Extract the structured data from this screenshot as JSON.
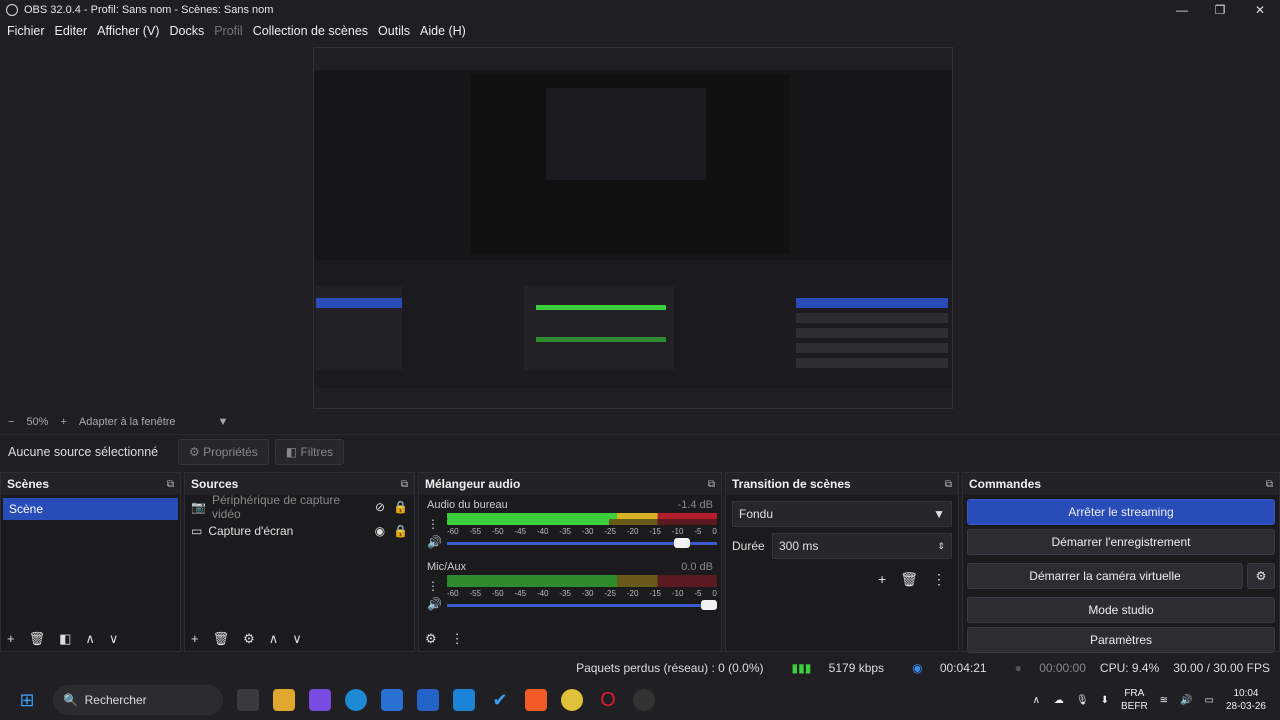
{
  "window": {
    "title": "OBS 32.0.4 - Profil: Sans nom - Scènes: Sans nom"
  },
  "menu": [
    "Fichier",
    "Editer",
    "Afficher (V)",
    "Docks",
    "Profil",
    "Collection de scènes",
    "Outils",
    "Aide (H)"
  ],
  "zoom": {
    "minus": "−",
    "level": "50%",
    "plus": "+",
    "fit": "Adapter à la fenêtre"
  },
  "sourcebar": {
    "none_selected": "Aucune source sélectionné",
    "properties": "Propriétés",
    "filters": "Filtres"
  },
  "scenes": {
    "title": "Scènes",
    "items": [
      "Scène"
    ]
  },
  "sources": {
    "title": "Sources",
    "items": [
      {
        "name": "Périphérique de capture vidéo",
        "icon": "camera-icon",
        "hidden": true
      },
      {
        "name": "Capture d'écran",
        "icon": "monitor-icon",
        "hidden": false
      }
    ]
  },
  "mixer": {
    "title": "Mélangeur audio",
    "channels": [
      {
        "name": "Audio du bureau",
        "db": "-1.4 dB",
        "level": 0.63,
        "fader": 0.9
      },
      {
        "name": "Mic/Aux",
        "db": "0.0 dB",
        "level": 0.63,
        "fader": 1.0
      }
    ],
    "scale": [
      "-60",
      "-55",
      "-50",
      "-45",
      "-40",
      "-35",
      "-30",
      "-25",
      "-20",
      "-15",
      "-10",
      "-5",
      "0"
    ]
  },
  "transitions": {
    "title": "Transition de scènes",
    "selected": "Fondu",
    "duration_label": "Durée",
    "duration": "300 ms"
  },
  "controls": {
    "title": "Commandes",
    "buttons": [
      "Arrêter le streaming",
      "Démarrer l'enregistrement",
      "Démarrer la caméra virtuelle",
      "Mode studio",
      "Paramètres"
    ]
  },
  "status": {
    "dropped": "Paquets perdus (réseau) : 0 (0.0%)",
    "bitrate": "5179 kbps",
    "stream_time": "00:04:21",
    "rec_time": "00:00:00",
    "cpu": "CPU: 9.4%",
    "fps": "30.00 / 30.00 FPS"
  },
  "taskbar": {
    "search": "Rechercher",
    "lang1": "FRA",
    "lang2": "BEFR",
    "time": "10:04",
    "date": "28-03-26"
  },
  "colors": {
    "accent": "#284cb8",
    "meter_green": "#3ccf3c",
    "meter_yellow": "#d7b224",
    "meter_red": "#b41e2c"
  }
}
